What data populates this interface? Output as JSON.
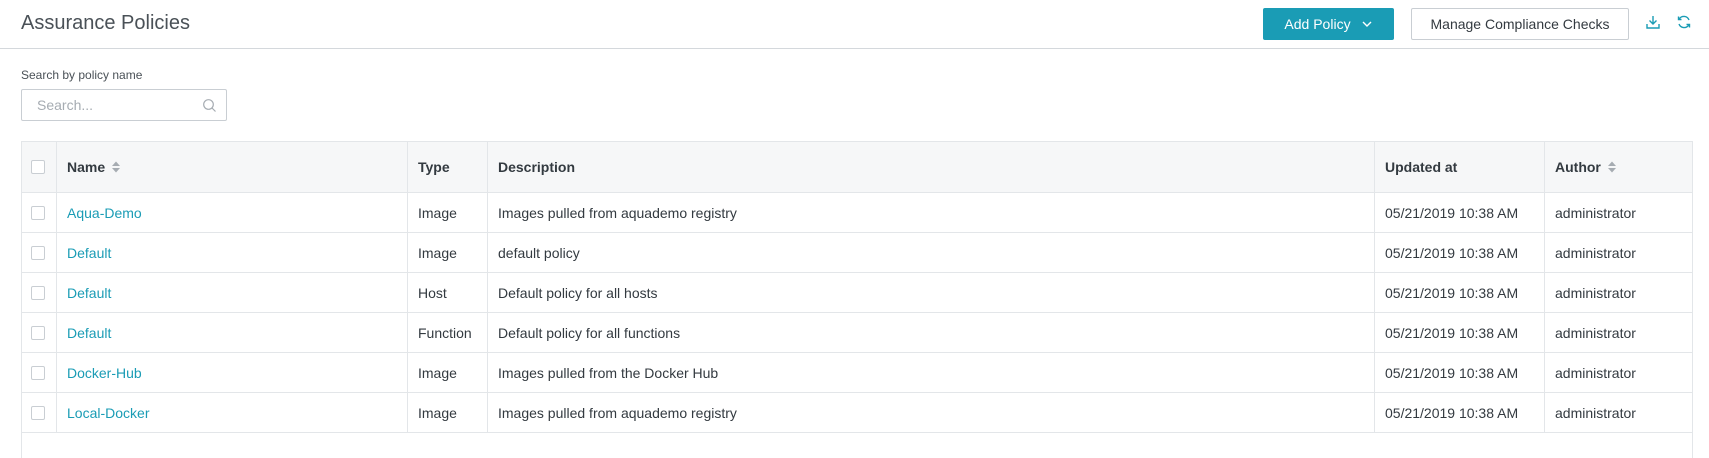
{
  "header": {
    "title": "Assurance Policies",
    "add_policy_label": "Add Policy",
    "manage_checks_label": "Manage Compliance Checks"
  },
  "search": {
    "label": "Search by policy name",
    "placeholder": "Search..."
  },
  "table": {
    "columns": {
      "name": "Name",
      "type": "Type",
      "description": "Description",
      "updated": "Updated at",
      "author": "Author"
    },
    "rows": [
      {
        "name": "Aqua-Demo",
        "type": "Image",
        "description": "Images pulled from aquademo registry",
        "updated": "05/21/2019 10:38 AM",
        "author": "administrator"
      },
      {
        "name": "Default",
        "type": "Image",
        "description": "default policy",
        "updated": "05/21/2019 10:38 AM",
        "author": "administrator"
      },
      {
        "name": "Default",
        "type": "Host",
        "description": "Default policy for all hosts",
        "updated": "05/21/2019 10:38 AM",
        "author": "administrator"
      },
      {
        "name": "Default",
        "type": "Function",
        "description": "Default policy for all functions",
        "updated": "05/21/2019 10:38 AM",
        "author": "administrator"
      },
      {
        "name": "Docker-Hub",
        "type": "Image",
        "description": "Images pulled from the Docker Hub",
        "updated": "05/21/2019 10:38 AM",
        "author": "administrator"
      },
      {
        "name": "Local-Docker",
        "type": "Image",
        "description": "Images pulled from aquademo registry",
        "updated": "05/21/2019 10:38 AM",
        "author": "administrator"
      }
    ]
  },
  "colors": {
    "accent": "#1a9cb5",
    "border": "#e3e6e9",
    "header_bg": "#f6f7f8"
  },
  "icons": [
    "chevron-down-icon",
    "download-icon",
    "refresh-icon",
    "search-icon",
    "sort-icon"
  ]
}
